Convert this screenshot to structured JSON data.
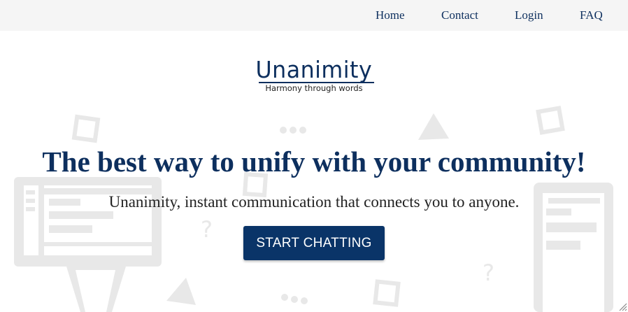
{
  "nav": {
    "items": [
      {
        "label": "Home"
      },
      {
        "label": "Contact"
      },
      {
        "label": "Login"
      },
      {
        "label": "FAQ"
      }
    ]
  },
  "logo": {
    "wordmark": "Unanimity",
    "tagline": "Harmony through words"
  },
  "hero": {
    "headline": "The best way to unify with your community!",
    "subheadline": "Unanimity, instant communication that connects you to anyone.",
    "cta_label": "START CHATTING"
  },
  "background_decor": {
    "question_mark": "?"
  },
  "colors": {
    "brand_navy": "#0d2f5e",
    "button": "#0a3468",
    "nav_bg": "#f5f5f5",
    "decor_gray": "#e8e8e8"
  }
}
